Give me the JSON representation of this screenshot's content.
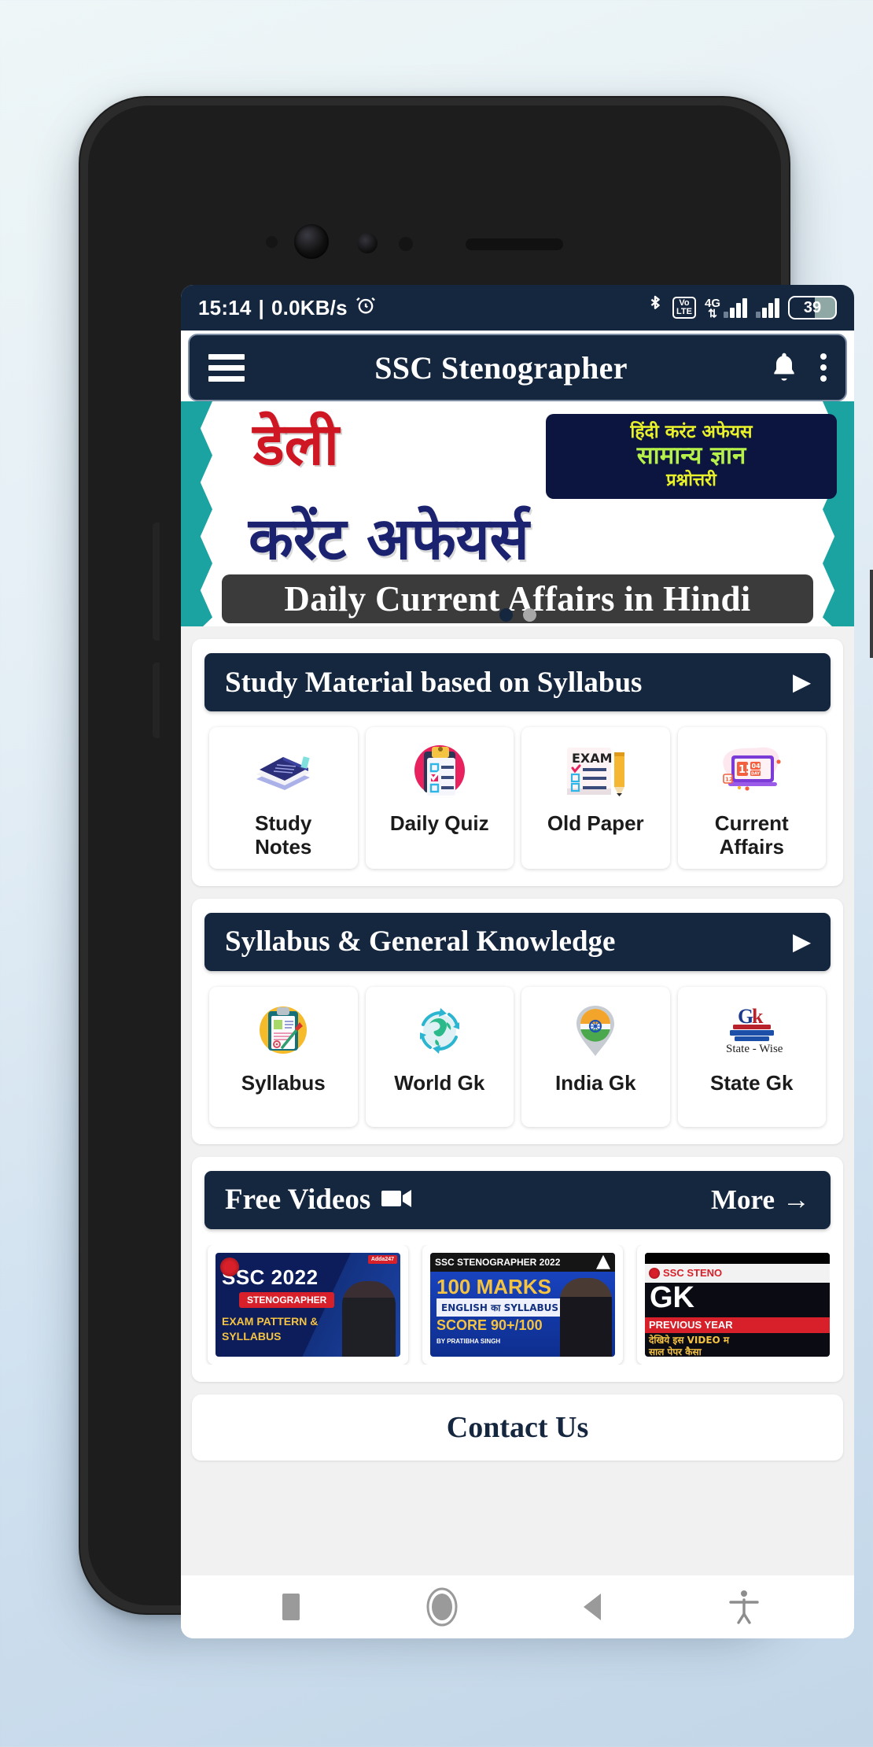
{
  "status_bar": {
    "time": "15:14",
    "separator": "|",
    "network_speed": "0.0KB/s",
    "alarm_icon": "alarm-icon",
    "bluetooth_icon": "bluetooth-icon",
    "volte_line1": "Vo",
    "volte_line2": "LTE",
    "network_type": "4G",
    "battery_level": "39"
  },
  "app_bar": {
    "menu_icon": "hamburger-menu-icon",
    "title": "SSC Stenographer",
    "notification_icon": "bell-icon",
    "overflow_icon": "kebab-menu-icon"
  },
  "banner": {
    "daily_hi": "डेली",
    "main_hi": "करेंट अफेयर्स",
    "badge_line1": "हिंदी करंट अफेयस",
    "badge_line2": "सामान्य ज्ञान",
    "badge_line3": "प्रश्नोत्तरी",
    "caption": "Daily Current Affairs in Hindi",
    "dots": [
      {
        "active": true,
        "color": "#15263f"
      },
      {
        "active": false,
        "color": "#a8a8a8"
      }
    ]
  },
  "sections": [
    {
      "title": "Study Material based on Syllabus",
      "caret": "▶",
      "tiles": [
        {
          "label": "Study\nNotes",
          "icon": "book-stack-icon"
        },
        {
          "label": "Daily Quiz",
          "icon": "clipboard-checklist-icon"
        },
        {
          "label": "Old Paper",
          "icon": "exam-paper-pencil-icon"
        },
        {
          "label": "Current\nAffairs",
          "icon": "calendar-laptop-icon"
        }
      ]
    },
    {
      "title": "Syllabus & General Knowledge",
      "caret": "▶",
      "tiles": [
        {
          "label": "Syllabus",
          "icon": "clipboard-pen-icon"
        },
        {
          "label": "World Gk",
          "icon": "globe-arrows-icon"
        },
        {
          "label": "India Gk",
          "icon": "india-flag-pin-icon"
        },
        {
          "label": "State Gk",
          "icon": "gk-books-icon",
          "sub": "State - Wise",
          "mark": "Gk"
        }
      ]
    }
  ],
  "videos_section": {
    "title": "Free Videos",
    "video_icon": "video-camera-icon",
    "more_label": "More",
    "more_arrow": "→",
    "items": [
      {
        "brand": "Adda247",
        "line1": "SSC 2022",
        "badge": "STENOGRAPHER",
        "line2": "EXAM PATTERN &",
        "line3": "SYLLABUS"
      },
      {
        "header": "SSC STENOGRAPHER 2022",
        "line1": "100 MARKS",
        "line2": "ENGLISH का SYLLABUS",
        "line3": "SCORE 90+/100",
        "byline": "BY PRATIBHA SINGH"
      },
      {
        "header": "SSC STENO",
        "line1": "GK",
        "badge": "PREVIOUS YEAR",
        "line2": "देखिये इस VIDEO म",
        "line3": "साल पेपर कैसा"
      }
    ]
  },
  "contact": {
    "title": "Contact Us"
  },
  "nav_bar": {
    "recents_icon": "recents-square-icon",
    "home_icon": "home-circle-icon",
    "back_icon": "back-triangle-icon",
    "accessibility_icon": "accessibility-icon"
  },
  "colors": {
    "brand_navy": "#15263f",
    "banner_red": "#cf1724",
    "banner_blue": "#1b2370",
    "teal": "#1aa3a0",
    "badge_navy": "#0b1540"
  }
}
